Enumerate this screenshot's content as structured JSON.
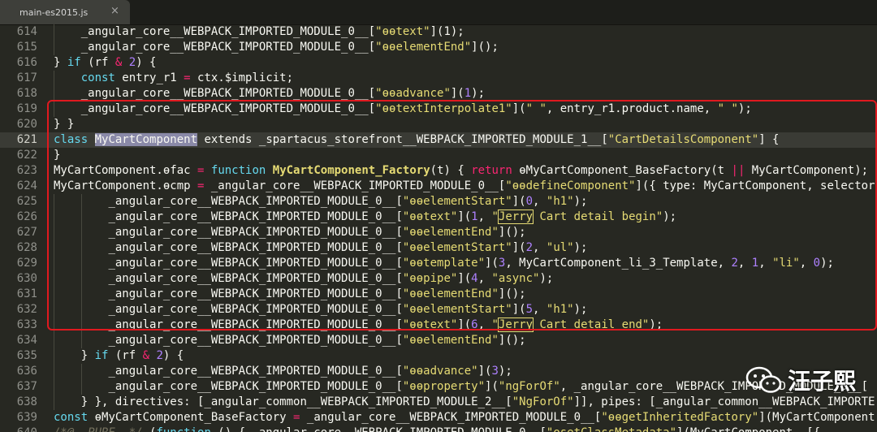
{
  "tab": {
    "title": "main-es2015.js",
    "close": "×"
  },
  "watermark": {
    "text": "汪子熙"
  },
  "lines": [
    {
      "num": "614",
      "indent": 4,
      "tokens": [
        [
          "_angular_core__WEBPACK_IMPORTED_MODULE_0__[",
          "p"
        ],
        [
          "\"ɵɵtext\"",
          "s"
        ],
        [
          "](1);",
          "p"
        ]
      ]
    },
    {
      "num": "615",
      "indent": 4,
      "tokens": [
        [
          "_angular_core__WEBPACK_IMPORTED_MODULE_0__[",
          "p"
        ],
        [
          "\"ɵɵelementEnd\"",
          "s"
        ],
        [
          "]();",
          "p"
        ]
      ]
    },
    {
      "num": "616",
      "indent": 0,
      "tokens": [
        [
          "} ",
          "p"
        ],
        [
          "if",
          "k"
        ],
        [
          " (rf ",
          "p"
        ],
        [
          "&",
          "o"
        ],
        [
          " ",
          "p"
        ],
        [
          "2",
          "n"
        ],
        [
          ") {",
          "p"
        ]
      ]
    },
    {
      "num": "617",
      "indent": 4,
      "tokens": [
        [
          "const",
          "k"
        ],
        [
          " entry_r1 ",
          "p"
        ],
        [
          "=",
          "o"
        ],
        [
          " ctx.$implicit;",
          "p"
        ]
      ]
    },
    {
      "num": "618",
      "indent": 4,
      "tokens": [
        [
          "_angular_core__WEBPACK_IMPORTED_MODULE_0__[",
          "p"
        ],
        [
          "\"ɵɵadvance\"",
          "s"
        ],
        [
          "](",
          "p"
        ],
        [
          "1",
          "n"
        ],
        [
          ");",
          "p"
        ]
      ]
    },
    {
      "num": "619",
      "indent": 4,
      "tokens": [
        [
          "_angular_core__WEBPACK_IMPORTED_MODULE_0__[",
          "p"
        ],
        [
          "\"ɵɵtextInterpolate1\"",
          "s"
        ],
        [
          "](",
          "p"
        ],
        [
          "\" \"",
          "s"
        ],
        [
          ", entry_r1.product.name, ",
          "p"
        ],
        [
          "\" \"",
          "s"
        ],
        [
          ");",
          "p"
        ]
      ]
    },
    {
      "num": "620",
      "indent": 0,
      "tokens": [
        [
          "} }",
          "p"
        ]
      ]
    },
    {
      "num": "621",
      "indent": 0,
      "current": true,
      "tokens": [
        [
          "class",
          "k"
        ],
        [
          " ",
          "p"
        ],
        [
          "MyCartComponent",
          "sel"
        ],
        [
          " extends _spartacus_storefront__WEBPACK_IMPORTED_MODULE_1__[",
          "p"
        ],
        [
          "\"CartDetailsComponent\"",
          "s"
        ],
        [
          "] {",
          "p"
        ]
      ]
    },
    {
      "num": "622",
      "indent": 0,
      "tokens": [
        [
          "}",
          "p"
        ]
      ]
    },
    {
      "num": "623",
      "indent": 0,
      "tokens": [
        [
          "MyCartComponent.ɵfac ",
          "p"
        ],
        [
          "=",
          "o"
        ],
        [
          " ",
          "p"
        ],
        [
          "function",
          "k"
        ],
        [
          " ",
          "p"
        ],
        [
          "MyCartComponent_Factory",
          "fb"
        ],
        [
          "(t) { ",
          "p"
        ],
        [
          "return",
          "r"
        ],
        [
          " ɵMyCartComponent_BaseFactory(t ",
          "p"
        ],
        [
          "||",
          "o"
        ],
        [
          " MyCartComponent);",
          "p"
        ]
      ]
    },
    {
      "num": "624",
      "indent": 0,
      "tokens": [
        [
          "MyCartComponent.ɵcmp ",
          "p"
        ],
        [
          "=",
          "o"
        ],
        [
          " _angular_core__WEBPACK_IMPORTED_MODULE_0__[",
          "p"
        ],
        [
          "\"ɵɵdefineComponent\"",
          "s"
        ],
        [
          "]({ type: MyCartComponent, selector",
          "p"
        ]
      ]
    },
    {
      "num": "625",
      "indent": 8,
      "tokens": [
        [
          "_angular_core__WEBPACK_IMPORTED_MODULE_0__[",
          "p"
        ],
        [
          "\"ɵɵelementStart\"",
          "s"
        ],
        [
          "](",
          "p"
        ],
        [
          "0",
          "n"
        ],
        [
          ", ",
          "p"
        ],
        [
          "\"h1\"",
          "s"
        ],
        [
          ");",
          "p"
        ]
      ]
    },
    {
      "num": "626",
      "indent": 8,
      "tokens": [
        [
          "_angular_core__WEBPACK_IMPORTED_MODULE_0__[",
          "p"
        ],
        [
          "\"ɵɵtext\"",
          "s"
        ],
        [
          "](",
          "p"
        ],
        [
          "1",
          "n"
        ],
        [
          ", ",
          "p"
        ],
        [
          "\"",
          "s"
        ],
        [
          "Jerry",
          "sb"
        ],
        [
          " Cart detail begin\"",
          "s"
        ],
        [
          ");",
          "p"
        ]
      ]
    },
    {
      "num": "627",
      "indent": 8,
      "tokens": [
        [
          "_angular_core__WEBPACK_IMPORTED_MODULE_0__[",
          "p"
        ],
        [
          "\"ɵɵelementEnd\"",
          "s"
        ],
        [
          "]();",
          "p"
        ]
      ]
    },
    {
      "num": "628",
      "indent": 8,
      "tokens": [
        [
          "_angular_core__WEBPACK_IMPORTED_MODULE_0__[",
          "p"
        ],
        [
          "\"ɵɵelementStart\"",
          "s"
        ],
        [
          "](",
          "p"
        ],
        [
          "2",
          "n"
        ],
        [
          ", ",
          "p"
        ],
        [
          "\"ul\"",
          "s"
        ],
        [
          ");",
          "p"
        ]
      ]
    },
    {
      "num": "629",
      "indent": 8,
      "tokens": [
        [
          "_angular_core__WEBPACK_IMPORTED_MODULE_0__[",
          "p"
        ],
        [
          "\"ɵɵtemplate\"",
          "s"
        ],
        [
          "](",
          "p"
        ],
        [
          "3",
          "n"
        ],
        [
          ", MyCartComponent_li_3_Template, ",
          "p"
        ],
        [
          "2",
          "n"
        ],
        [
          ", ",
          "p"
        ],
        [
          "1",
          "n"
        ],
        [
          ", ",
          "p"
        ],
        [
          "\"li\"",
          "s"
        ],
        [
          ", ",
          "p"
        ],
        [
          "0",
          "n"
        ],
        [
          ");",
          "p"
        ]
      ]
    },
    {
      "num": "630",
      "indent": 8,
      "tokens": [
        [
          "_angular_core__WEBPACK_IMPORTED_MODULE_0__[",
          "p"
        ],
        [
          "\"ɵɵpipe\"",
          "s"
        ],
        [
          "](",
          "p"
        ],
        [
          "4",
          "n"
        ],
        [
          ", ",
          "p"
        ],
        [
          "\"async\"",
          "s"
        ],
        [
          ");",
          "p"
        ]
      ]
    },
    {
      "num": "631",
      "indent": 8,
      "tokens": [
        [
          "_angular_core__WEBPACK_IMPORTED_MODULE_0__[",
          "p"
        ],
        [
          "\"ɵɵelementEnd\"",
          "s"
        ],
        [
          "]();",
          "p"
        ]
      ]
    },
    {
      "num": "632",
      "indent": 8,
      "tokens": [
        [
          "_angular_core__WEBPACK_IMPORTED_MODULE_0__[",
          "p"
        ],
        [
          "\"ɵɵelementStart\"",
          "s"
        ],
        [
          "](",
          "p"
        ],
        [
          "5",
          "n"
        ],
        [
          ", ",
          "p"
        ],
        [
          "\"h1\"",
          "s"
        ],
        [
          ");",
          "p"
        ]
      ]
    },
    {
      "num": "633",
      "indent": 8,
      "tokens": [
        [
          "_angular_core__WEBPACK_IMPORTED_MODULE_0__[",
          "p"
        ],
        [
          "\"ɵɵtext\"",
          "s"
        ],
        [
          "](",
          "p"
        ],
        [
          "6",
          "n"
        ],
        [
          ", ",
          "p"
        ],
        [
          "\"",
          "s"
        ],
        [
          "Jerry",
          "sb"
        ],
        [
          " Cart detail end\"",
          "s"
        ],
        [
          ");",
          "p"
        ]
      ]
    },
    {
      "num": "634",
      "indent": 8,
      "tokens": [
        [
          "_angular_core__WEBPACK_IMPORTED_MODULE_0__[",
          "p"
        ],
        [
          "\"ɵɵelementEnd\"",
          "s"
        ],
        [
          "]();",
          "p"
        ]
      ]
    },
    {
      "num": "635",
      "indent": 4,
      "tokens": [
        [
          "} ",
          "p"
        ],
        [
          "if",
          "k"
        ],
        [
          " (rf ",
          "p"
        ],
        [
          "&",
          "o"
        ],
        [
          " ",
          "p"
        ],
        [
          "2",
          "n"
        ],
        [
          ") {",
          "p"
        ]
      ]
    },
    {
      "num": "636",
      "indent": 8,
      "tokens": [
        [
          "_angular_core__WEBPACK_IMPORTED_MODULE_0__[",
          "p"
        ],
        [
          "\"ɵɵadvance\"",
          "s"
        ],
        [
          "](",
          "p"
        ],
        [
          "3",
          "n"
        ],
        [
          ");",
          "p"
        ]
      ]
    },
    {
      "num": "637",
      "indent": 8,
      "tokens": [
        [
          "_angular_core__WEBPACK_IMPORTED_MODULE_0__[",
          "p"
        ],
        [
          "\"ɵɵproperty\"",
          "s"
        ],
        [
          "](",
          "p"
        ],
        [
          "\"ngForOf\"",
          "s"
        ],
        [
          ", _angular_core__WEBPACK_IMPORTED_MODULE_0__[",
          "p"
        ]
      ]
    },
    {
      "num": "638",
      "indent": 4,
      "tokens": [
        [
          "} }, directives: [_angular_common__WEBPACK_IMPORTED_MODULE_2__[",
          "p"
        ],
        [
          "\"NgForOf\"",
          "s"
        ],
        [
          "]], pipes: [_angular_common__WEBPACK_IMPORTE",
          "p"
        ]
      ]
    },
    {
      "num": "639",
      "indent": 0,
      "tokens": [
        [
          "const",
          "k"
        ],
        [
          " ɵMyCartComponent_BaseFactory ",
          "p"
        ],
        [
          "=",
          "o"
        ],
        [
          " _angular_core__WEBPACK_IMPORTED_MODULE_0__[",
          "p"
        ],
        [
          "\"ɵɵgetInheritedFactory\"",
          "s"
        ],
        [
          "](MyCartComponent",
          "p"
        ]
      ]
    },
    {
      "num": "640",
      "indent": 0,
      "tokens": [
        [
          "/*@__PURE__*/",
          "c"
        ],
        [
          " (",
          "p"
        ],
        [
          "function",
          "k"
        ],
        [
          " () { _angular_core__WEBPACK_IMPORTED_MODULE_0__[",
          "p"
        ],
        [
          "\"ɵsetClassMetadata\"",
          "s"
        ],
        [
          "](MyCartComponent, [{",
          "p"
        ]
      ]
    }
  ]
}
